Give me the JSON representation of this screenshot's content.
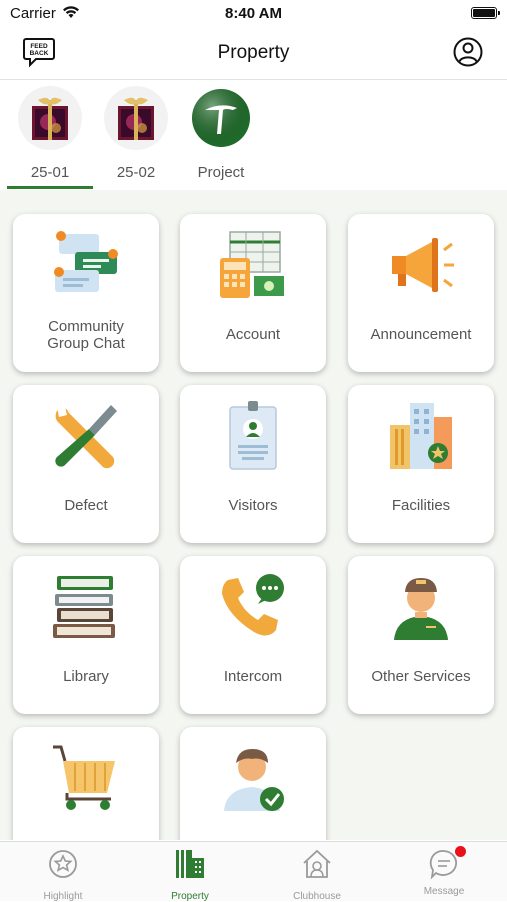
{
  "status": {
    "carrier": "Carrier",
    "time": "8:40 AM"
  },
  "nav": {
    "title": "Property",
    "left_icon": "feedback-icon",
    "right_icon": "profile-icon"
  },
  "properties": [
    {
      "label": "25-01",
      "active": true
    },
    {
      "label": "25-02",
      "active": false
    },
    {
      "label": "Project",
      "active": false
    }
  ],
  "tiles": [
    {
      "label": "Community\nGroup Chat",
      "icon": "community-chat-icon"
    },
    {
      "label": "Account",
      "icon": "account-icon"
    },
    {
      "label": "Announcement",
      "icon": "megaphone-icon"
    },
    {
      "label": "Defect",
      "icon": "tools-icon"
    },
    {
      "label": "Visitors",
      "icon": "visitor-badge-icon"
    },
    {
      "label": "Facilities",
      "icon": "buildings-icon"
    },
    {
      "label": "Library",
      "icon": "books-icon"
    },
    {
      "label": "Intercom",
      "icon": "phone-icon"
    },
    {
      "label": "Other Services",
      "icon": "staff-icon"
    },
    {
      "label": "",
      "icon": "cart-icon"
    },
    {
      "label": "",
      "icon": "verified-user-icon"
    }
  ],
  "tabs": [
    {
      "label": "Highlight",
      "icon": "star-icon",
      "active": false
    },
    {
      "label": "Property",
      "icon": "building-icon",
      "active": true
    },
    {
      "label": "Clubhouse",
      "icon": "house-icon",
      "active": false
    },
    {
      "label": "Message",
      "icon": "message-icon",
      "active": false,
      "badge": true
    }
  ],
  "colors": {
    "accent": "#2e7d32",
    "badge": "#e8121c",
    "grid_bg": "#f4f6f2"
  }
}
